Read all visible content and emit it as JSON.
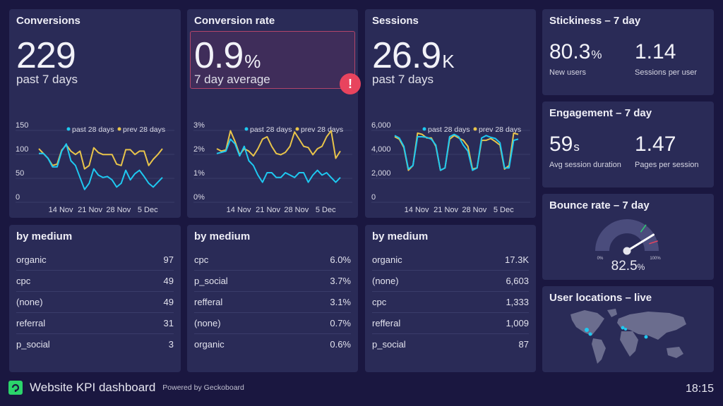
{
  "colors": {
    "past": "#1ec8f0",
    "prev": "#e8c44a",
    "alert": "#e8445e",
    "good": "#2ecc71",
    "bad": "#e8445e"
  },
  "legend": {
    "past": "past 28 days",
    "prev": "prev 28 days"
  },
  "x_labels": [
    "14 Nov",
    "21 Nov",
    "28 Nov",
    "5 Dec"
  ],
  "conversions": {
    "title": "Conversions",
    "value": "229",
    "subtitle": "past 7 days"
  },
  "conversion_rate": {
    "title": "Conversion rate",
    "value": "0.9",
    "unit": "%",
    "subtitle": "7 day average",
    "alert_icon": "exclamation-icon"
  },
  "sessions": {
    "title": "Sessions",
    "value": "26.9",
    "unit": "K",
    "subtitle": "past 7 days"
  },
  "chart_data": [
    {
      "type": "line",
      "y_ticks": [
        "0",
        "50",
        "100",
        "150"
      ],
      "ylim": [
        0,
        150
      ],
      "x_tick_labels": [
        "14 Nov",
        "21 Nov",
        "28 Nov",
        "5 Dec"
      ],
      "grid": true,
      "legend": "top-right",
      "series": [
        {
          "name": "past 28 days",
          "values": [
            90,
            90,
            80,
            62,
            62,
            95,
            110,
            75,
            65,
            40,
            15,
            28,
            58,
            45,
            40,
            42,
            35,
            20,
            28,
            55,
            35,
            48,
            55,
            42,
            28,
            20,
            30,
            40
          ]
        },
        {
          "name": "prev 28 days",
          "values": [
            100,
            90,
            80,
            65,
            68,
            97,
            108,
            95,
            88,
            95,
            58,
            65,
            102,
            92,
            88,
            88,
            88,
            68,
            65,
            98,
            98,
            88,
            95,
            95,
            65,
            78,
            88,
            100
          ]
        }
      ]
    },
    {
      "type": "line",
      "y_ticks": [
        "0%",
        "1%",
        "2%",
        "3%"
      ],
      "ylim": [
        0,
        3
      ],
      "x_tick_labels": [
        "14 Nov",
        "21 Nov",
        "28 Nov",
        "5 Dec"
      ],
      "grid": true,
      "legend": "top-right",
      "series": [
        {
          "name": "past 28 days",
          "values": [
            1.8,
            1.85,
            1.9,
            2.4,
            2.2,
            1.7,
            2.1,
            1.5,
            1.3,
            0.9,
            0.6,
            1.0,
            1.0,
            0.8,
            0.8,
            1.0,
            0.9,
            0.8,
            1.0,
            1.0,
            0.6,
            0.9,
            1.1,
            0.9,
            1.0,
            0.8,
            0.6,
            0.8
          ]
        },
        {
          "name": "prev 28 days",
          "values": [
            2.0,
            1.9,
            1.95,
            2.75,
            2.3,
            1.75,
            2.0,
            1.9,
            1.7,
            2.0,
            2.4,
            2.5,
            2.1,
            1.8,
            1.75,
            1.85,
            2.1,
            2.7,
            2.4,
            2.1,
            2.05,
            1.75,
            2.0,
            2.1,
            2.5,
            2.75,
            1.6,
            1.9
          ]
        }
      ]
    },
    {
      "type": "line",
      "y_ticks": [
        "0",
        "2,000",
        "4,000",
        "6,000"
      ],
      "ylim": [
        0,
        6000
      ],
      "x_tick_labels": [
        "14 Nov",
        "21 Nov",
        "28 Nov",
        "5 Dec"
      ],
      "grid": true,
      "legend": "top-right",
      "series": [
        {
          "name": "past 28 days",
          "values": [
            5100,
            4900,
            4200,
            2300,
            2600,
            5000,
            5000,
            4950,
            4800,
            4300,
            2200,
            2400,
            5000,
            5200,
            5000,
            4300,
            3800,
            2200,
            2400,
            4900,
            5100,
            4950,
            4850,
            4500,
            2400,
            2400,
            4700,
            4800
          ]
        },
        {
          "name": "prev 28 days",
          "values": [
            5000,
            4800,
            4100,
            2200,
            2600,
            5300,
            5200,
            4900,
            4900,
            4200,
            2200,
            2400,
            4800,
            5100,
            4900,
            4700,
            4200,
            2300,
            2400,
            4700,
            4700,
            4850,
            4600,
            4300,
            2300,
            2600,
            5300,
            5200
          ]
        }
      ]
    }
  ],
  "medium": [
    {
      "title": "by medium",
      "rows": [
        [
          "organic",
          "97"
        ],
        [
          "cpc",
          "49"
        ],
        [
          "(none)",
          "49"
        ],
        [
          "referral",
          "31"
        ],
        [
          "p_social",
          "3"
        ]
      ]
    },
    {
      "title": "by medium",
      "rows": [
        [
          "cpc",
          "6.0%"
        ],
        [
          "p_social",
          "3.7%"
        ],
        [
          "refferal",
          "3.1%"
        ],
        [
          "(none)",
          "0.7%"
        ],
        [
          "organic",
          "0.6%"
        ]
      ]
    },
    {
      "title": "by medium",
      "rows": [
        [
          "organic",
          "17.3K"
        ],
        [
          "(none)",
          "6,603"
        ],
        [
          "cpc",
          "1,333"
        ],
        [
          "refferal",
          "1,009"
        ],
        [
          "p_social",
          "87"
        ]
      ]
    }
  ],
  "stickiness": {
    "title": "Stickiness – 7 day",
    "a_value": "80.3",
    "a_unit": "%",
    "a_label": "New users",
    "b_value": "1.14",
    "b_label": "Sessions per user"
  },
  "engagement": {
    "title": "Engagement – 7 day",
    "a_value": "59",
    "a_unit": "s",
    "a_label": "Avg session duration",
    "b_value": "1.47",
    "b_label": "Pages per session"
  },
  "bounce": {
    "title": "Bounce rate – 7 day",
    "value": "82.5",
    "unit": "%",
    "min": "0%",
    "max": "100%",
    "percent": 82.5,
    "good_mark": 70,
    "bad_mark": 90
  },
  "locations": {
    "title": "User locations – live"
  },
  "footer": {
    "title": "Website KPI dashboard",
    "powered": "Powered by Geckoboard",
    "time": "18:15"
  }
}
